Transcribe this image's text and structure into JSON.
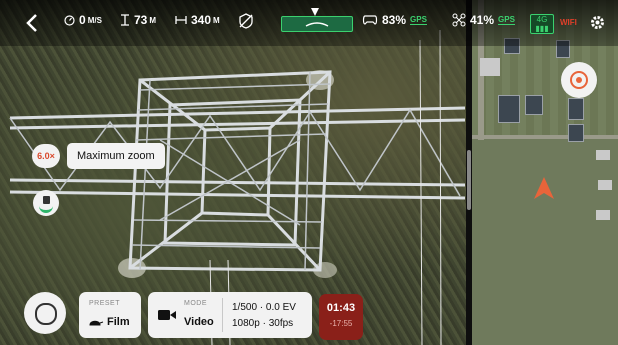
{
  "topbar": {
    "speed_value": "0",
    "speed_unit": "M/S",
    "altitude_value": "73",
    "altitude_unit": "M",
    "distance_value": "340",
    "distance_unit": "M",
    "controller_battery": "83%",
    "gps_label": "GPS",
    "drone_battery": "41%",
    "gps_label_2": "GPS",
    "network_label": "4G",
    "wifi_label": "WIFI",
    "battery_level_fraction": 0.83
  },
  "zoom": {
    "value": "6.0×",
    "message": "Maximum zoom"
  },
  "bottom": {
    "preset_caption": "PRESET",
    "preset_value": "Film",
    "mode_caption": "MODE",
    "mode_value": "Video",
    "exposure": "1/500 · 0.0 EV",
    "resolution": "1080p · 30fps",
    "record_time": "01:43",
    "record_remaining": "-17:55"
  },
  "colors": {
    "accent_orange": "#e8643a",
    "gps_green": "#3bd16f",
    "record_red": "#8a2019",
    "panel_bg": "#f2f2f2"
  }
}
